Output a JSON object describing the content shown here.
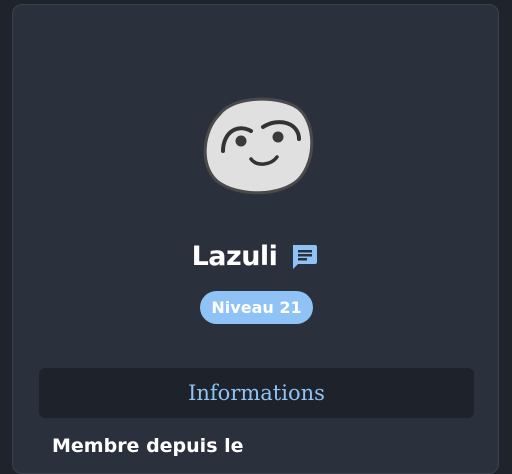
{
  "profile": {
    "name": "Lazuli",
    "level_label": "Niveau 21"
  },
  "icons": {
    "avatar": "face-avatar-icon",
    "name_action": "chat-icon"
  },
  "section": {
    "title": "Informations",
    "member_since_label": "Membre depuis le"
  },
  "colors": {
    "background": "#1f242c",
    "card": "#2b313c",
    "accent": "#8fc3f5",
    "section_bar": "#1e232b"
  }
}
